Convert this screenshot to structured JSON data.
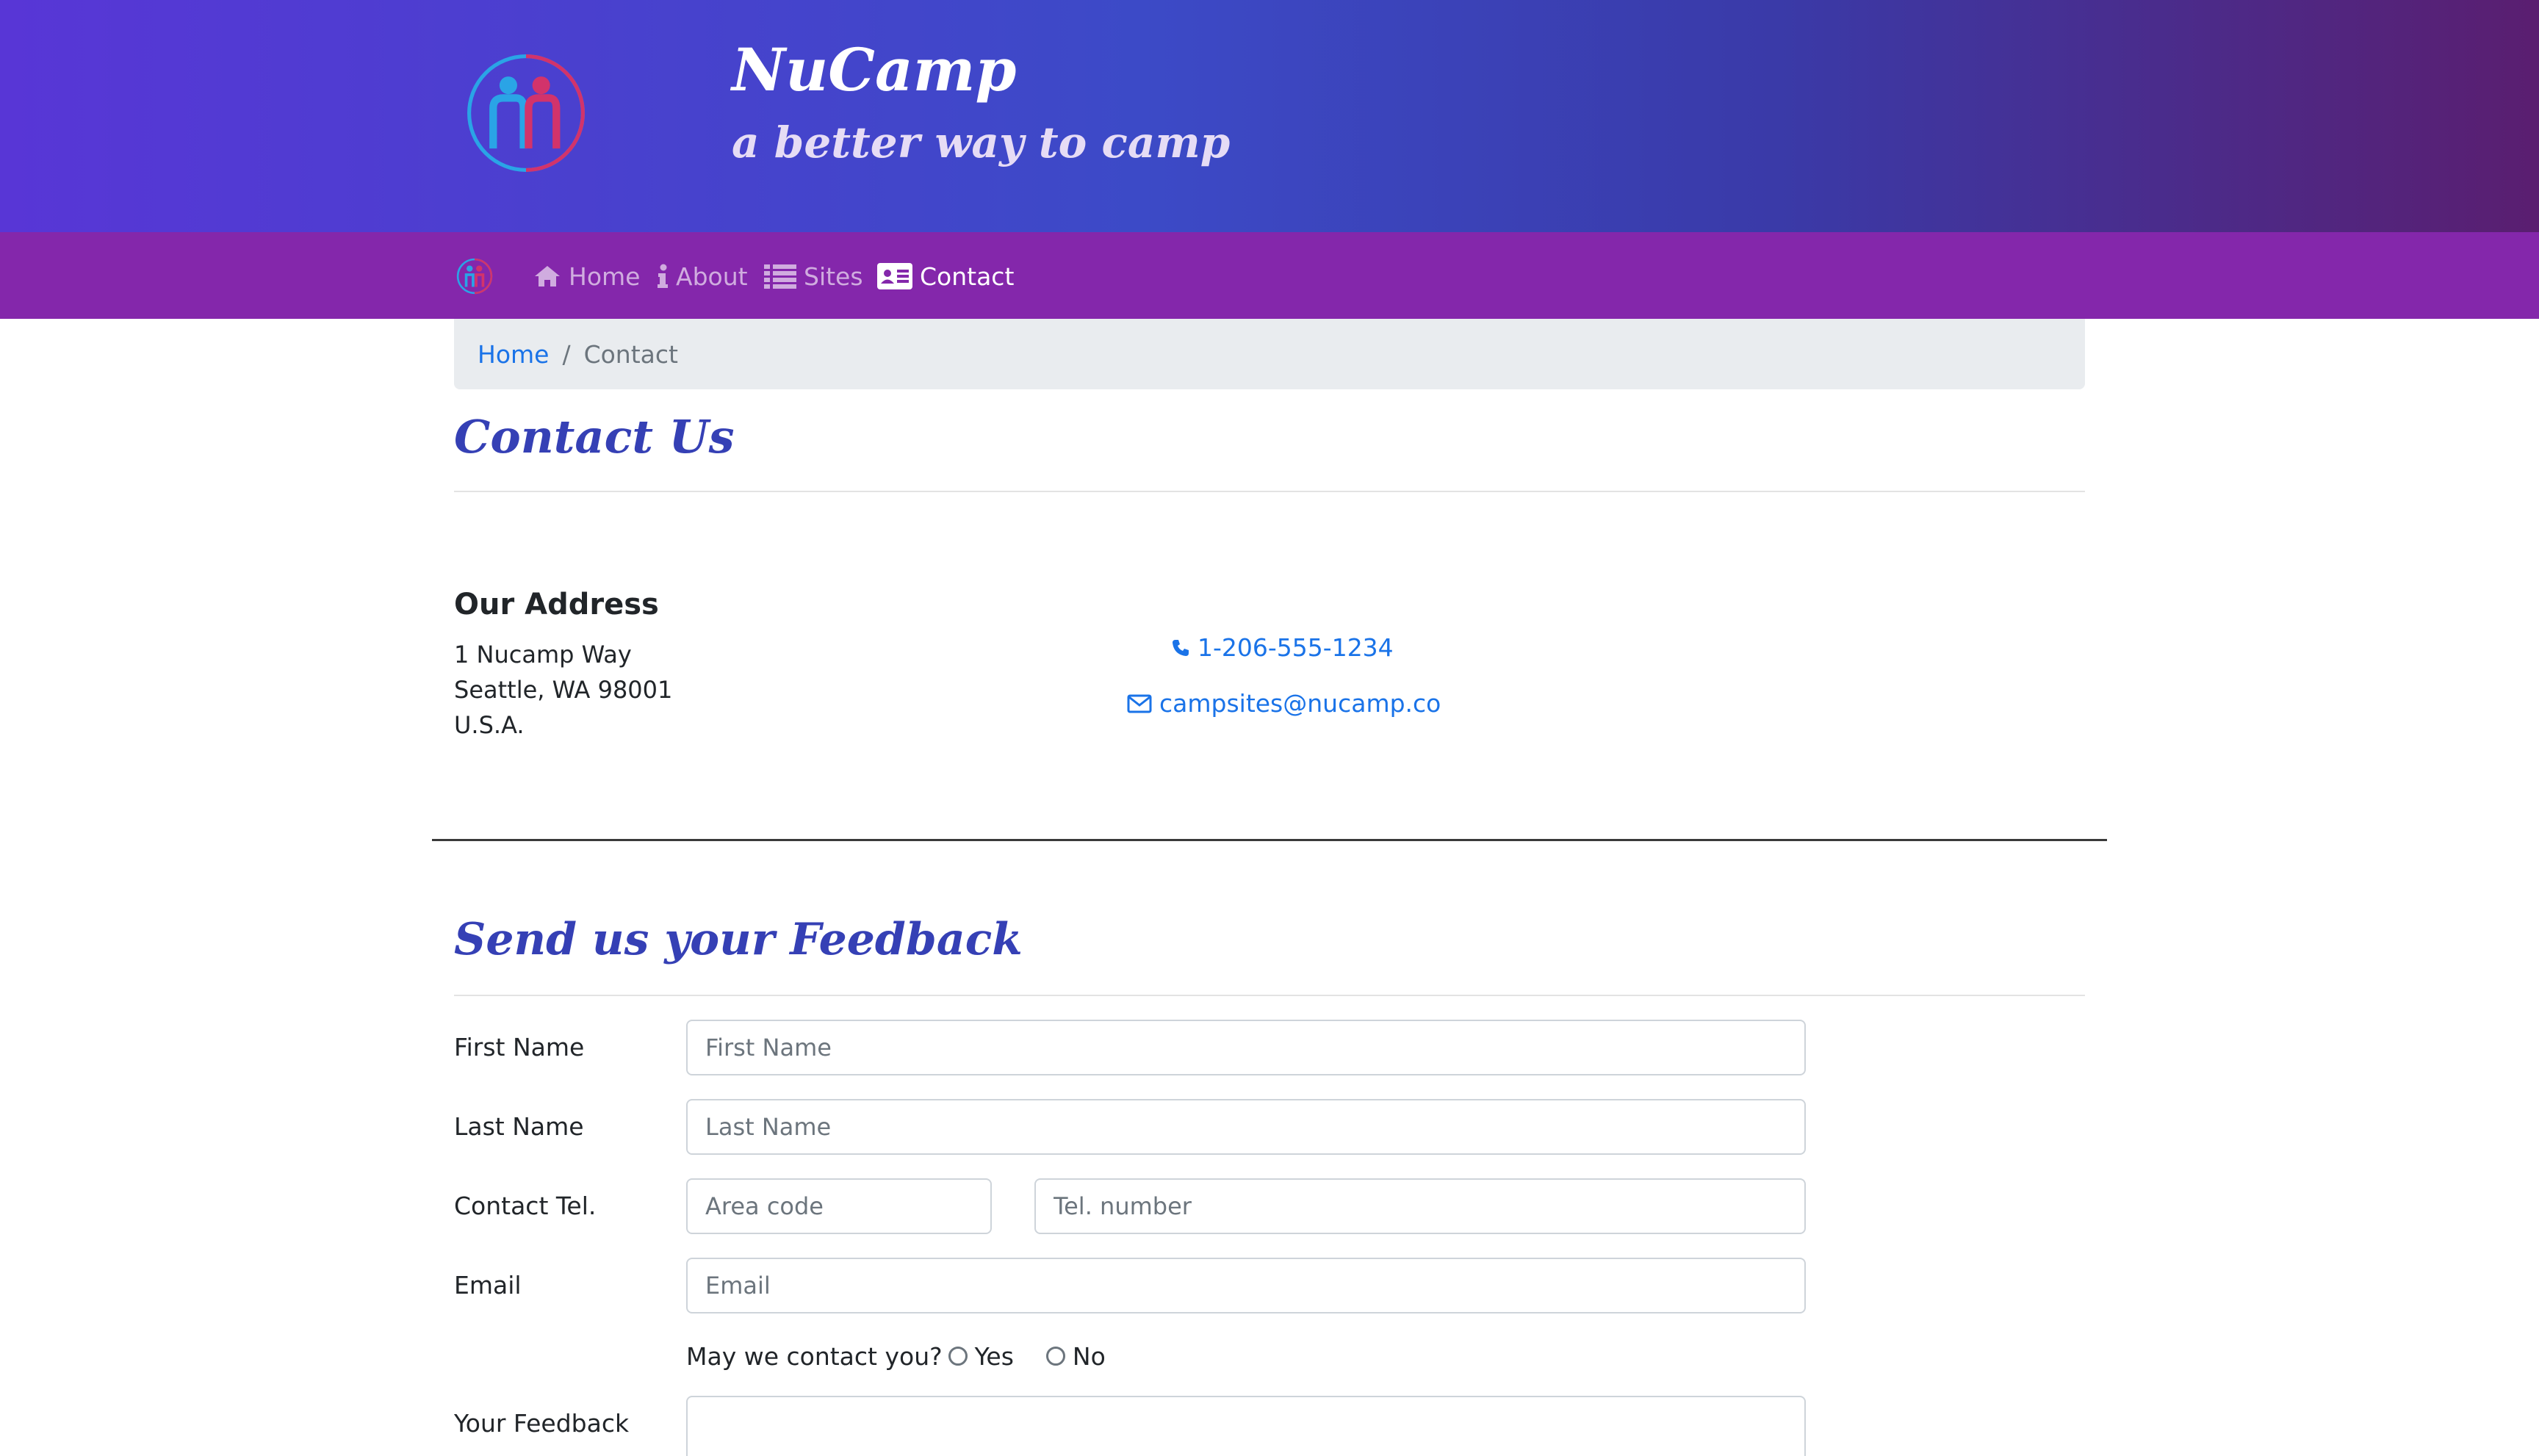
{
  "header": {
    "brand_title": "NuCamp",
    "brand_subtitle": "a better way to camp"
  },
  "nav": {
    "items": [
      {
        "label": "Home",
        "icon": "home-icon",
        "active": false
      },
      {
        "label": "About",
        "icon": "info-icon",
        "active": false
      },
      {
        "label": "Sites",
        "icon": "list-icon",
        "active": false
      },
      {
        "label": "Contact",
        "icon": "address-card-icon",
        "active": true
      }
    ]
  },
  "breadcrumb": {
    "home": "Home",
    "separator": "/",
    "current": "Contact"
  },
  "contact": {
    "heading": "Contact Us",
    "address_title": "Our Address",
    "address_lines": [
      "1 Nucamp Way",
      "Seattle, WA 98001",
      "U.S.A."
    ],
    "phone": "1-206-555-1234",
    "email": "campsites@nucamp.co"
  },
  "feedback": {
    "heading": "Send us your Feedback",
    "fields": {
      "first_name": {
        "label": "First Name",
        "placeholder": "First Name",
        "value": ""
      },
      "last_name": {
        "label": "Last Name",
        "placeholder": "Last Name",
        "value": ""
      },
      "contact_tel": {
        "label": "Contact Tel.",
        "area_placeholder": "Area code",
        "number_placeholder": "Tel. number"
      },
      "email": {
        "label": "Email",
        "placeholder": "Email",
        "value": ""
      },
      "feedback": {
        "label": "Your Feedback",
        "value": ""
      }
    },
    "may_contact": {
      "question": "May we contact you?",
      "yes": "Yes",
      "no": "No"
    }
  },
  "colors": {
    "navbar": "#8427ab",
    "heading": "#3540b5",
    "link": "#1a73e8"
  }
}
